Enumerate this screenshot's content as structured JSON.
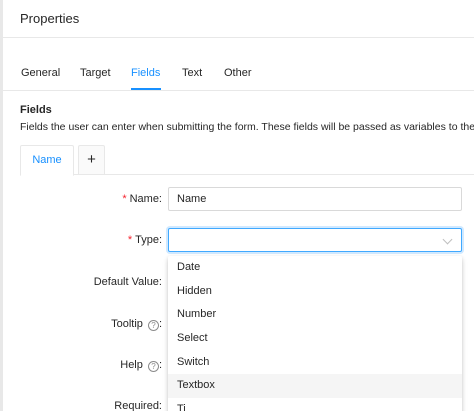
{
  "header": {
    "title": "Properties"
  },
  "tabs": [
    {
      "label": "General"
    },
    {
      "label": "Target"
    },
    {
      "label": "Fields"
    },
    {
      "label": "Text"
    },
    {
      "label": "Other"
    }
  ],
  "active_tab": "Fields",
  "section": {
    "title": "Fields",
    "description": "Fields the user can enter when submitting the form. These fields will be passed as variables to the ta"
  },
  "subtabs": {
    "current": "Name",
    "add": "+"
  },
  "form": {
    "name_label": "Name:",
    "name_value": "Name",
    "type_label": "Type:",
    "type_value": "",
    "default_label": "Default Value:",
    "tooltip_label": "Tooltip",
    "help_label": "Help",
    "required_label": "Required:",
    "required_marker": "*",
    "help_glyph": "?",
    "colon": ":"
  },
  "type_options": [
    "Date",
    "Hidden",
    "Number",
    "Select",
    "Switch",
    "Textbox",
    "Ti"
  ],
  "hovered_option": "Textbox",
  "colors": {
    "accent": "#1890ff",
    "required": "#f5222d",
    "hover": "#f5f5f5"
  }
}
